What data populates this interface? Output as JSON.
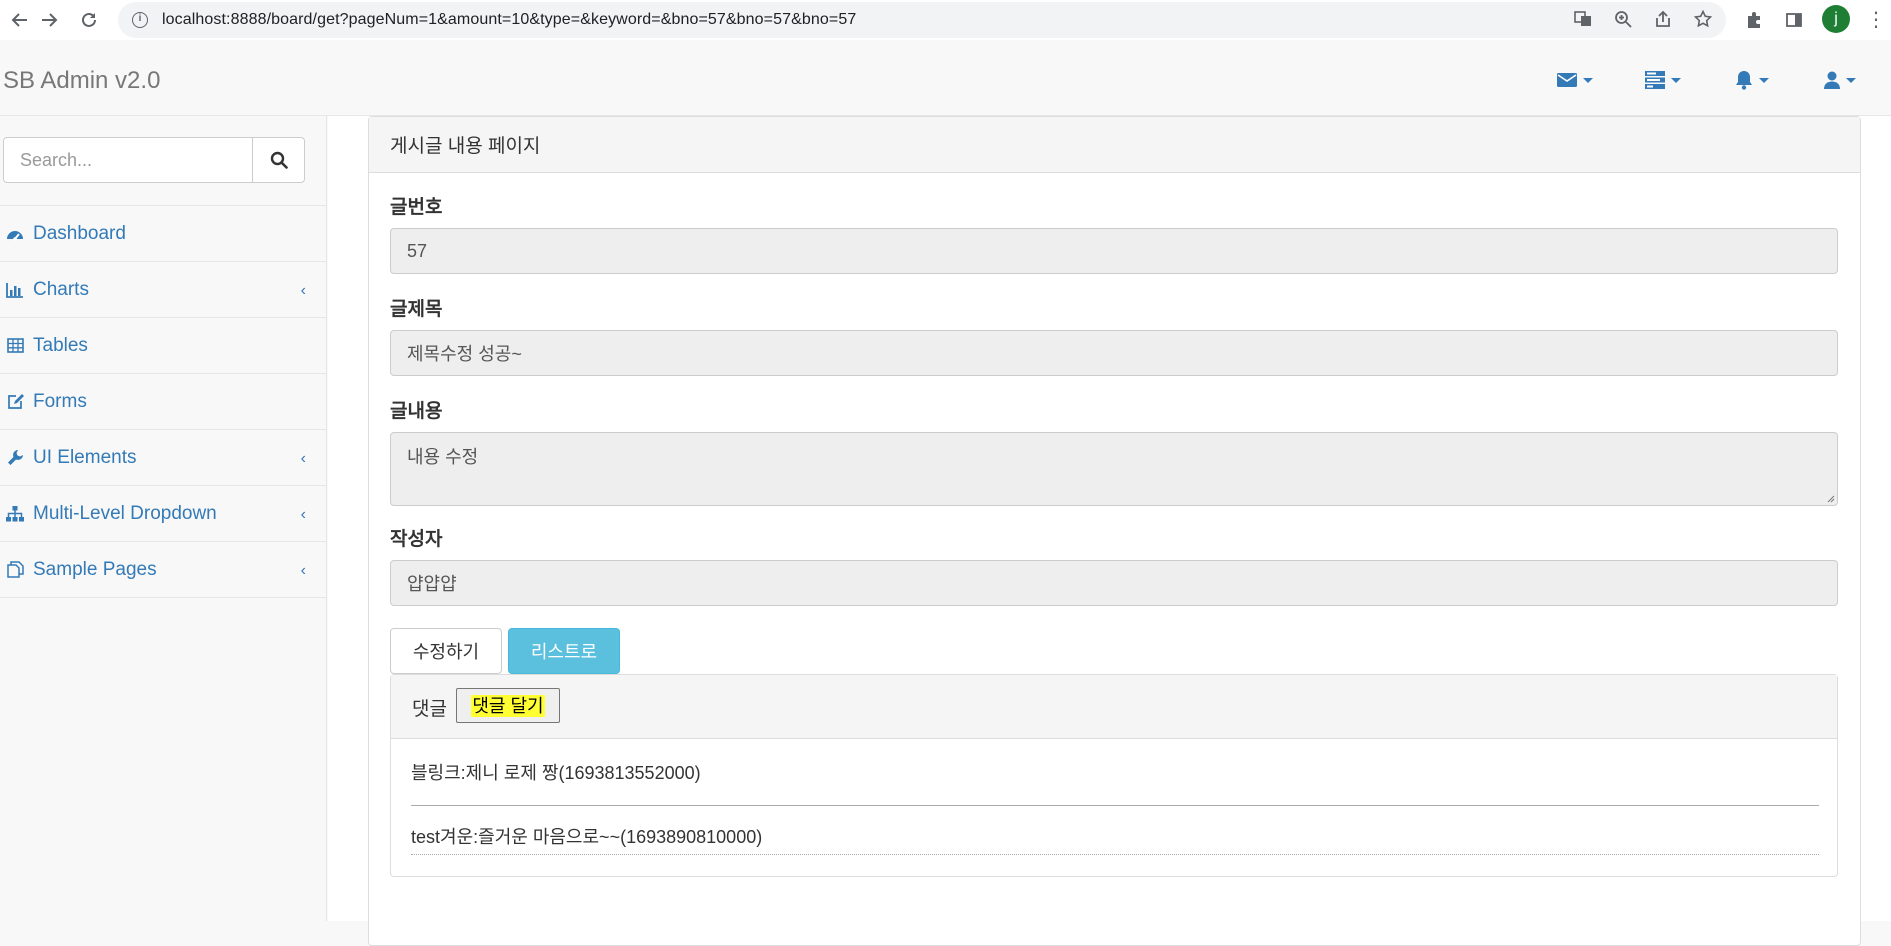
{
  "browser": {
    "url": "localhost:8888/board/get?pageNum=1&amount=10&type=&keyword=&bno=57&bno=57&bno=57",
    "profile_initial": "j"
  },
  "navbar": {
    "brand": "SB Admin v2.0"
  },
  "sidebar": {
    "search_placeholder": "Search...",
    "items": [
      {
        "label": "Dashboard",
        "icon": "dashboard-icon",
        "has_submenu": false
      },
      {
        "label": "Charts",
        "icon": "bar-chart-icon",
        "has_submenu": true
      },
      {
        "label": "Tables",
        "icon": "table-icon",
        "has_submenu": false
      },
      {
        "label": "Forms",
        "icon": "edit-icon",
        "has_submenu": false
      },
      {
        "label": "UI Elements",
        "icon": "wrench-icon",
        "has_submenu": true
      },
      {
        "label": "Multi-Level Dropdown",
        "icon": "sitemap-icon",
        "has_submenu": true
      },
      {
        "label": "Sample Pages",
        "icon": "files-icon",
        "has_submenu": true
      }
    ]
  },
  "main": {
    "panel_title": "게시글 내용 페이지",
    "fields": {
      "bno_label": "글번호",
      "bno_value": "57",
      "title_label": "글제목",
      "title_value": "제목수정 성공~",
      "content_label": "글내용",
      "content_value": "내용 수정",
      "writer_label": "작성자",
      "writer_value": "얍얍얍"
    },
    "buttons": {
      "modify": "수정하기",
      "list": "리스트로"
    },
    "reply": {
      "title": "댓글",
      "add_button": "댓글 달기",
      "items": [
        "블링크:제니 로제 짱(1693813552000)",
        "test겨운:즐거운 마음으로~~(1693890810000)"
      ]
    }
  },
  "colors": {
    "link": "#337ab7",
    "info_button": "#5bc0de",
    "highlight": "#ffff33",
    "profile": "#1e7e34"
  }
}
